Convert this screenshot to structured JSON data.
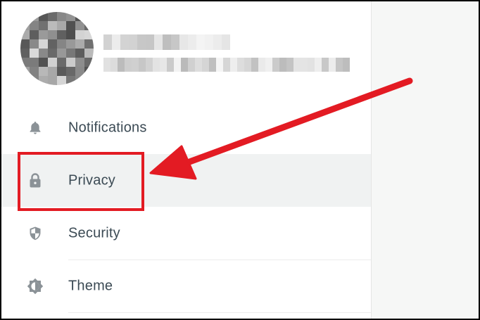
{
  "menu": {
    "items": [
      {
        "label": "Notifications",
        "icon": "bell-icon"
      },
      {
        "label": "Privacy",
        "icon": "lock-icon",
        "selected": true
      },
      {
        "label": "Security",
        "icon": "shield-icon"
      },
      {
        "label": "Theme",
        "icon": "theme-icon"
      }
    ]
  },
  "annotation": {
    "highlight_color": "#e31b23",
    "highlighted_item": "Privacy"
  },
  "colors": {
    "label": "#3b4a54",
    "icon": "#8b9297",
    "selected_background": "#f0f2f2",
    "right_pane_background": "#f6f7f6",
    "top_strip": "#0b6b58"
  }
}
